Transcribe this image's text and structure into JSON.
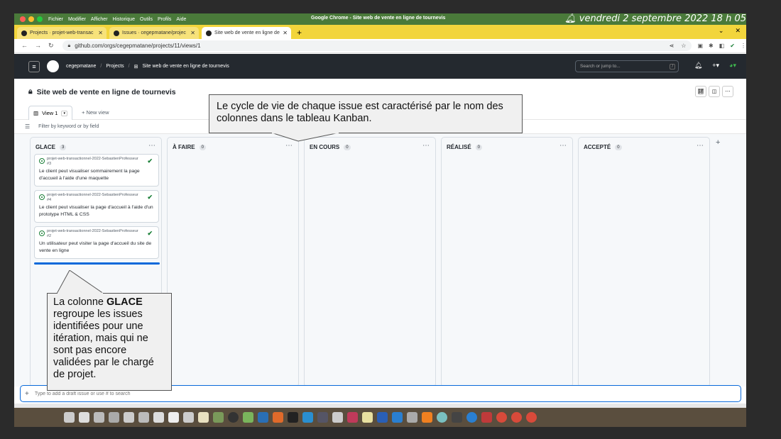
{
  "os": {
    "menus": [
      "Fichier",
      "Modifier",
      "Afficher",
      "Historique",
      "Outils",
      "Profils",
      "Aide"
    ],
    "window_title": "Google Chrome - Site web de vente en ligne de tournevis",
    "clock": "vendredi 2 septembre 2022  18 h 05"
  },
  "tabs": [
    {
      "label": "Projects · projet-web-transac"
    },
    {
      "label": "Issues · cegepmatane/projec"
    },
    {
      "label": "Site web de vente en ligne de"
    }
  ],
  "address": {
    "url": "github.com/orgs/cegepmatane/projects/11/views/1"
  },
  "github": {
    "org": "cegepmatane",
    "projects": "Projects",
    "project_name": "Site web de vente en ligne de tournevis",
    "search_placeholder": "Search or jump to...",
    "search_key": "/"
  },
  "project": {
    "title": "Site web de vente en ligne de tournevis",
    "view_tab": "View 1",
    "new_view": "New view",
    "filter_placeholder": "Filter by keyword or by field"
  },
  "columns": [
    {
      "name": "GLACE",
      "count": "3"
    },
    {
      "name": "À FAIRE",
      "count": "0"
    },
    {
      "name": "EN COURS",
      "count": "0"
    },
    {
      "name": "RÉALISÉ",
      "count": "0"
    },
    {
      "name": "ACCEPTÉ",
      "count": "0"
    }
  ],
  "cards": [
    {
      "repo": "projet-web-transactionnel-2022-SebastienProfesseur #3",
      "title": "Le client peut visualiser sommairement la page d'accueil à l'aide d'une maquette"
    },
    {
      "repo": "projet-web-transactionnel-2022-SebastienProfesseur #4",
      "title": "Le client peut visualiser la page d'accueil à l'aide d'un prototype HTML & CSS"
    },
    {
      "repo": "projet-web-transactionnel-2022-SebastienProfesseur #2",
      "title": "Un utilisateur peut visiter la page d'accueil du site de vente en ligne"
    }
  ],
  "draft": {
    "placeholder": "Type to add a draft issue or use # to search"
  },
  "callouts": {
    "top": "Le cycle de vie de chaque issue est caractérisé par le nom des colonnes dans le tableau Kanban.",
    "left_pre": "La colonne ",
    "left_bold": "GLACE",
    "left_post": " regroupe les issues identifiées pour une itération, mais qui ne sont pas encore validées par le chargé de projet."
  },
  "colors": {
    "accent": "#0969da",
    "success": "#1a7f37",
    "header_bg": "#24292f",
    "tabs_bg": "#f2d53c"
  }
}
